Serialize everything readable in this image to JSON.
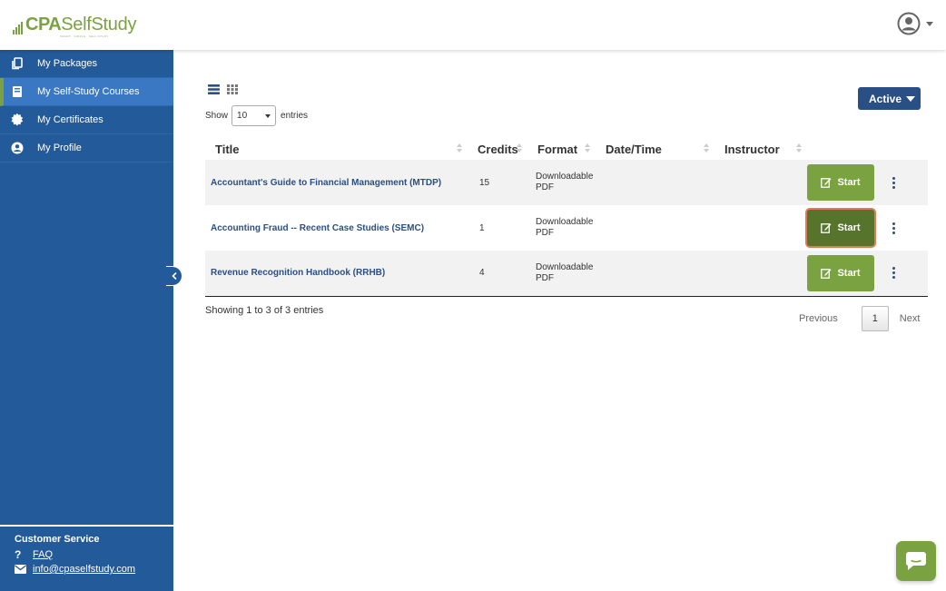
{
  "brand": {
    "name_strong": "CPA",
    "name_light": "SelfStudy",
    "tagline": "SMART · SIMPLE · SELF-STUDY",
    "color": "#7ba241"
  },
  "header": {
    "user_icon": "user-circle-icon"
  },
  "sidebar": {
    "items": [
      {
        "label": "My Packages",
        "icon": "copy-icon",
        "active": false
      },
      {
        "label": "My Self-Study Courses",
        "icon": "book-icon",
        "active": true
      },
      {
        "label": "My Certificates",
        "icon": "certificate-icon",
        "active": false
      },
      {
        "label": "My Profile",
        "icon": "user-icon",
        "active": false
      }
    ],
    "customer_service": {
      "title": "Customer Service",
      "faq": "FAQ",
      "email": "info@cpaselfstudy.com"
    }
  },
  "main": {
    "status_filter": "Active",
    "show_label": "Show",
    "page_length": "10",
    "entries_label": "entries",
    "columns": [
      "Title",
      "Credits",
      "Format",
      "Date/Time",
      "Instructor"
    ],
    "rows": [
      {
        "title": "Accountant's Guide to Financial Management (MTDP)",
        "credits": "15",
        "format_line1": "Downloadable",
        "format_line2": "PDF",
        "datetime": "",
        "instructor": "",
        "action": "Start"
      },
      {
        "title": "Accounting Fraud -- Recent Case Studies (SEMC)",
        "credits": "1",
        "format_line1": "Downloadable",
        "format_line2": "PDF",
        "datetime": "",
        "instructor": "",
        "action": "Start"
      },
      {
        "title": "Revenue Recognition Handbook (RRHB)",
        "credits": "4",
        "format_line1": "Downloadable",
        "format_line2": "PDF",
        "datetime": "",
        "instructor": "",
        "action": "Start"
      }
    ],
    "info": "Showing 1 to 3 of 3 entries",
    "pagination": {
      "previous": "Previous",
      "current": "1",
      "next": "Next"
    }
  },
  "colors": {
    "sidebar": "#235a9a",
    "sidebar_active": "#3a78c3",
    "primary_dark": "#2a4f84",
    "start_green": "#7ba241",
    "start_focused": "#56742c"
  }
}
